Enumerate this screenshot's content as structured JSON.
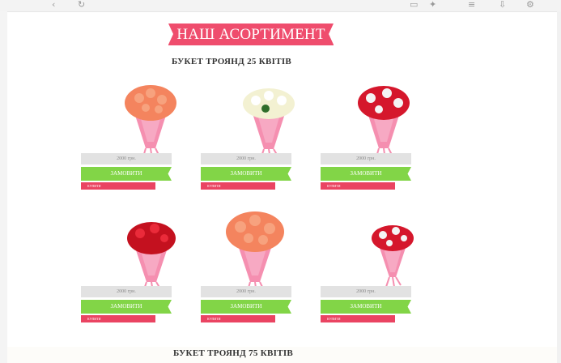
{
  "browser": {
    "icons": [
      "back-icon",
      "refresh-icon",
      "tab-icon",
      "bookmark-icon",
      "menu-icon",
      "download-icon",
      "settings-icon"
    ]
  },
  "catalog": {
    "title": "НАШ АСОРТИМЕНТ",
    "section1_title": "БУКЕТ ТРОЯНД 25 КВІТІВ",
    "section2_title": "БУКЕТ ТРОЯНД 75 КВІТІВ",
    "products": [
      {
        "price": "2000 грн.",
        "order_label": "ЗАМОВИТИ",
        "buy_label": "КУПИТИ",
        "flower_color": "#f4845e",
        "flower_highlight": "#f7a27e"
      },
      {
        "price": "2000 грн.",
        "order_label": "ЗАМОВИТИ",
        "buy_label": "КУПИТИ",
        "flower_color": "#f3f1d2",
        "flower_highlight": "#ffffff"
      },
      {
        "price": "2000 грн.",
        "order_label": "ЗАМОВИТИ",
        "buy_label": "КУПИТИ",
        "flower_color": "#d5172c",
        "flower_highlight": "#f4f4f4"
      },
      {
        "price": "2000 грн.",
        "order_label": "ЗАМОВИТИ",
        "buy_label": "КУПИТИ",
        "flower_color": "#c4111f",
        "flower_highlight": "#ea2b3a"
      },
      {
        "price": "2000 грн.",
        "order_label": "ЗАМОВИТИ",
        "buy_label": "КУПИТИ",
        "flower_color": "#f4845e",
        "flower_highlight": "#f7a27e"
      },
      {
        "price": "2000 грн.",
        "order_label": "ЗАМОВИТИ",
        "buy_label": "КУПИТИ",
        "flower_color": "#d5172c",
        "flower_highlight": "#f4f4f4"
      }
    ]
  }
}
